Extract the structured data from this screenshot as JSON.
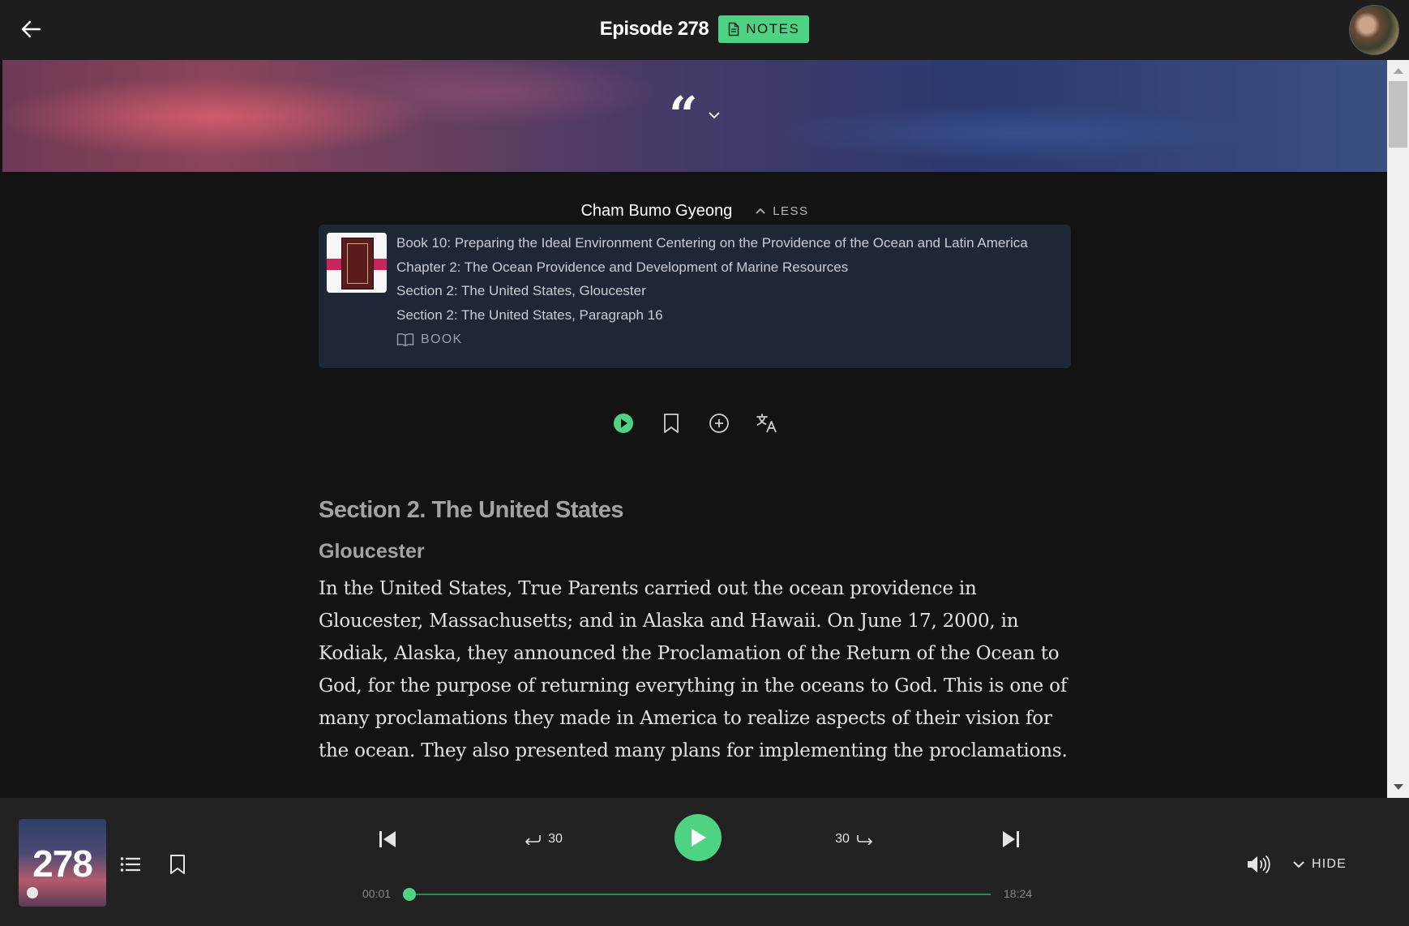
{
  "header": {
    "title": "Episode 278",
    "notes_label": "NOTES"
  },
  "quote": {
    "glyph": "“"
  },
  "source": {
    "name": "Cham Bumo Gyeong",
    "less_label": "LESS",
    "lines": [
      "Book 10: Preparing the Ideal Environment Centering on the Providence of the Ocean and Latin America",
      "Chapter 2: The Ocean Providence and Development of Marine Resources",
      "Section 2: The United States, Gloucester",
      "Section 2: The United States, Paragraph 16"
    ],
    "book_label": "BOOK"
  },
  "actions": {
    "icons": [
      "play-circle-icon",
      "bookmark-icon",
      "add-circle-icon",
      "translate-icon"
    ]
  },
  "article": {
    "section_title": "Section 2. The United States",
    "subtitle": "Gloucester",
    "paragraph": "In the United States, True Parents carried out the ocean providence in Gloucester, Massachusetts; and in Alaska and Hawaii. On June 17, 2000, in Kodiak, Alaska, they announced the Proclamation of the Return of the Ocean to God, for the purpose of returning everything in the oceans to God. This is one of many proclamations they made in America to realize aspects of their vision for the ocean. They also presented many plans for implementing the proclamations."
  },
  "player": {
    "episode_number": "278",
    "rewind_label": "30",
    "forward_label": "30",
    "current_time": "00:01",
    "total_time": "18:24",
    "progress": 0.001,
    "hide_label": "HIDE",
    "accent_color": "#4ed383"
  },
  "colors": {
    "background": "#131313",
    "topbar": "#1d1d1d",
    "card": "#1e2736",
    "player": "#222222"
  }
}
